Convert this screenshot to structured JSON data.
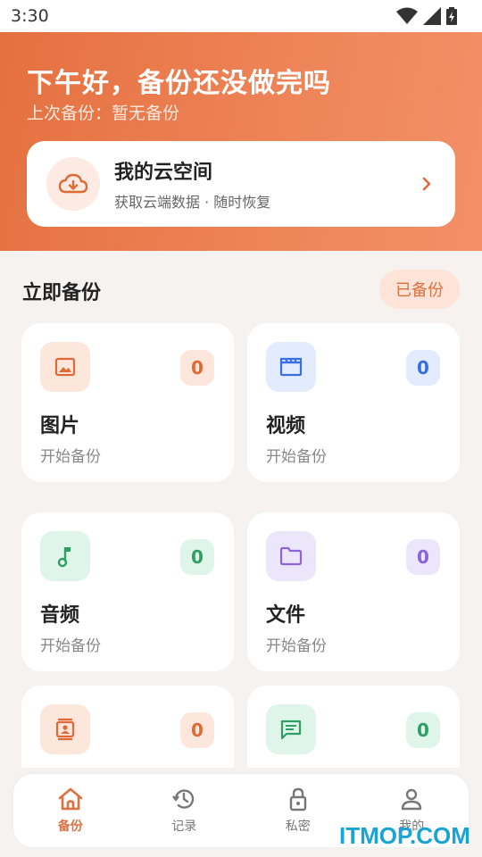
{
  "status_bar": {
    "time": "3:30"
  },
  "hero": {
    "greeting": "下午好，备份还没做完吗",
    "last_backup": "上次备份：暂无备份"
  },
  "cloud_card": {
    "title": "我的云空间",
    "subtitle": "获取云端数据 · 随时恢复"
  },
  "section": {
    "title": "立即备份",
    "backed_label": "已备份"
  },
  "cards": [
    {
      "title": "图片",
      "subtitle": "开始备份",
      "count": "0",
      "icon": "image-icon",
      "color": "#e06a35"
    },
    {
      "title": "视频",
      "subtitle": "开始备份",
      "count": "0",
      "icon": "video-icon",
      "color": "#3b6fe0"
    },
    {
      "title": "音频",
      "subtitle": "开始备份",
      "count": "0",
      "icon": "music-note-icon",
      "color": "#2e9e65"
    },
    {
      "title": "文件",
      "subtitle": "开始备份",
      "count": "0",
      "icon": "folder-icon",
      "color": "#8a64d8"
    },
    {
      "title": "",
      "subtitle": "",
      "count": "0",
      "icon": "contacts-icon",
      "color": "#e06a35"
    },
    {
      "title": "",
      "subtitle": "",
      "count": "0",
      "icon": "message-icon",
      "color": "#2e9e65"
    }
  ],
  "bottom_nav": [
    {
      "label": "备份",
      "icon": "home-icon",
      "active": true
    },
    {
      "label": "记录",
      "icon": "history-icon",
      "active": false
    },
    {
      "label": "私密",
      "icon": "lock-icon",
      "active": false
    },
    {
      "label": "我的",
      "icon": "person-icon",
      "active": false
    }
  ],
  "watermark": "ITMOP.COM",
  "colors": {
    "accent": "#e5703f",
    "background": "#f5f2f0"
  }
}
